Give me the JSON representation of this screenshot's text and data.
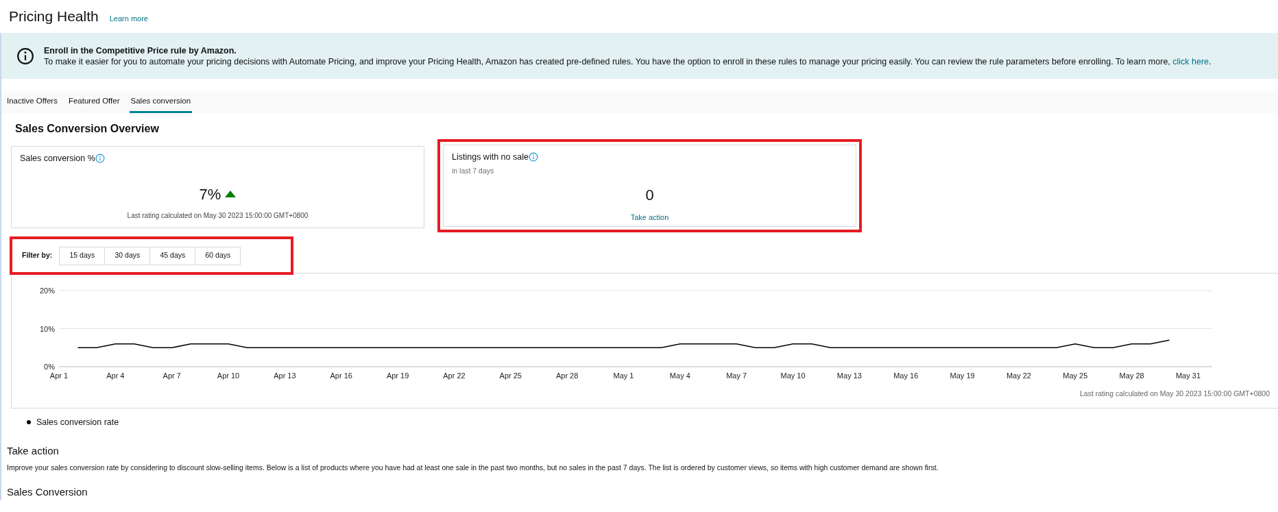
{
  "page": {
    "title": "Pricing Health",
    "learn_more": "Learn more"
  },
  "banner": {
    "heading": "Enroll in the Competitive Price rule by Amazon.",
    "body": "To make it easier for you to automate your pricing decisions with Automate Pricing, and improve your Pricing Health, Amazon has created pre-defined rules. You have the option to enroll in these rules to manage your pricing easily. You can review the rule parameters before enrolling. To learn more, ",
    "link": "click here",
    "trailing": "."
  },
  "tabs": [
    {
      "label": "Inactive Offers",
      "selected": false
    },
    {
      "label": "Featured Offer",
      "selected": false
    },
    {
      "label": "Sales conversion",
      "selected": true
    }
  ],
  "section_title": "Sales Conversion Overview",
  "cards": [
    {
      "kind": "rate",
      "title": "Sales conversion %",
      "value": "7%",
      "trend_up": true,
      "note": "Last rating calculated on May 30 2023 15:00:00 GMT+0800",
      "highlighted": false
    },
    {
      "kind": "count",
      "title": "Listings with no sale",
      "subtitle": "in last 7 days",
      "value": "0",
      "action": "Take action",
      "highlighted": true
    }
  ],
  "filter": {
    "label": "Filter by:",
    "highlighted": true,
    "options": [
      {
        "label": "15 days",
        "selected": false
      },
      {
        "label": "30 days",
        "selected": false
      },
      {
        "label": "45 days",
        "selected": false
      },
      {
        "label": "60 days",
        "selected": false
      }
    ]
  },
  "chart": {
    "chart_data": {
      "type": "line",
      "ylim": [
        0,
        20
      ],
      "categories": [
        "Apr 1",
        null,
        null,
        "Apr 4",
        null,
        null,
        "Apr 7",
        null,
        null,
        "Apr 10",
        null,
        null,
        "Apr 13",
        null,
        null,
        "Apr 16",
        null,
        null,
        "Apr 19",
        null,
        null,
        "Apr 22",
        null,
        null,
        "Apr 25",
        null,
        null,
        "Apr 28",
        null,
        null,
        "May 1",
        null,
        null,
        "May 4",
        null,
        null,
        "May 7",
        null,
        null,
        "May 10",
        null,
        null,
        "May 13",
        null,
        null,
        "May 16",
        null,
        null,
        "May 19",
        null,
        null,
        "May 22",
        null,
        null,
        "May 25",
        null,
        null,
        "May 28",
        null,
        null,
        "May 31"
      ],
      "series": [
        {
          "name": "Sales conversion rate",
          "color": "#000000",
          "values": [
            null,
            5,
            5,
            6,
            6,
            5,
            5,
            6,
            6,
            6,
            5,
            5,
            5,
            5,
            5,
            5,
            5,
            5,
            5,
            5,
            5,
            5,
            5,
            5,
            5,
            5,
            5,
            5,
            5,
            5,
            5,
            5,
            5,
            6,
            6,
            6,
            6,
            5,
            5,
            6,
            6,
            5,
            5,
            5,
            5,
            5,
            5,
            5,
            5,
            5,
            5,
            5,
            5,
            5,
            6,
            5,
            5,
            6,
            6,
            7,
            null
          ]
        }
      ],
      "yticks": [
        {
          "value": 0,
          "label": "0%"
        },
        {
          "value": 10,
          "label": "10%"
        },
        {
          "value": 20,
          "label": "20%"
        }
      ]
    },
    "note": "Last rating calculated on May 30 2023 15:00:00 GMT+0800"
  },
  "take_action": {
    "title": "Take action",
    "text": "Improve your sales conversion rate by considering to discount slow-selling items. Below is a list of products where you have had at least one sale in the past two months, but no sales in the past 7 days. The list is ordered by customer views, so items with high customer demand are shown first."
  },
  "next_section": {
    "title": "Sales Conversion"
  }
}
